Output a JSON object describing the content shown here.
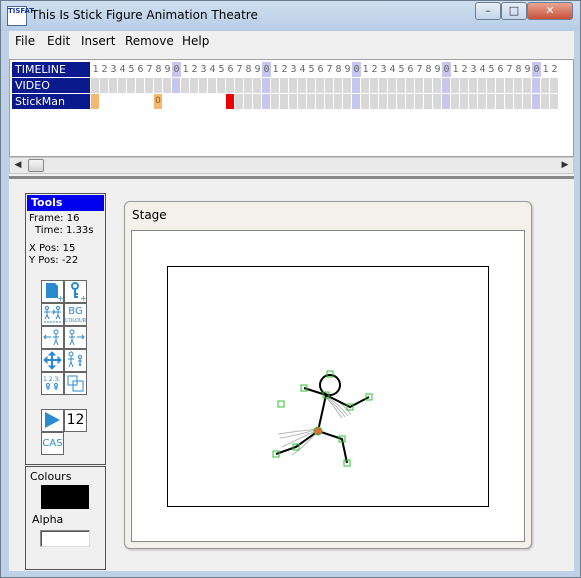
{
  "window": {
    "title": "This Is Stick Figure Animation Theatre",
    "app_icon_text": "TISFAT",
    "buttons": [
      "minimize",
      "maximize",
      "close"
    ]
  },
  "menu": [
    "File",
    "Edit",
    "Insert",
    "Remove",
    "Help"
  ],
  "timeline": {
    "header_digits": "1234567890",
    "rows": [
      {
        "label": "TIMELINE"
      },
      {
        "label": "VIDEO"
      },
      {
        "label": "StickMan"
      }
    ],
    "keyframe_label": "0",
    "colors": {
      "label_bg": "#0a1a8c",
      "cell_gray": "#d8d8d8",
      "tenth_highlight": "#c6c6ee",
      "keyframe_orange": "#f4b870",
      "keyframe_red": "#ee0000"
    }
  },
  "tools": {
    "title": "Tools",
    "frame_label": "Frame:",
    "frame_value": "16",
    "time_label": "Time:",
    "time_value": "1.33s",
    "xpos_label": "X Pos:",
    "xpos_value": "15",
    "ypos_label": "Y Pos:",
    "ypos_value": "-22",
    "bg_label": "BG",
    "colour_label": "COLOUR",
    "play_count": "12",
    "cas_label": "CAS",
    "icon_names": [
      "new-sprite-icon",
      "new-key-icon",
      "move-figure-icon",
      "bg-colour-icon",
      "flip-left-icon",
      "flip-right-icon",
      "move-all-icon",
      "scale-icon",
      "numbering-icon",
      "layers-icon",
      "play-icon",
      "cas-icon"
    ]
  },
  "colours": {
    "title": "Colours",
    "swatch": "#000000",
    "alpha_label": "Alpha",
    "alpha_value": ""
  },
  "stage": {
    "title": "Stage"
  }
}
